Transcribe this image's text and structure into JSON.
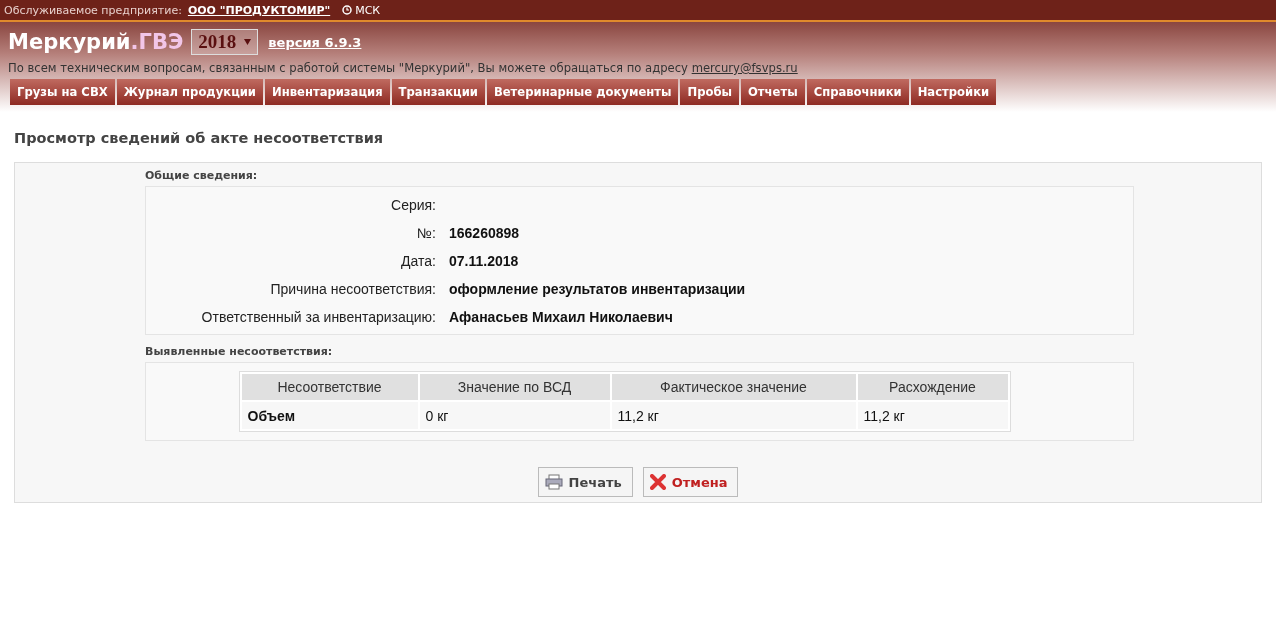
{
  "topbar": {
    "enterprise_label": "Обслуживаемое предприятие:",
    "enterprise": "ООО \"ПРОДУКТОМИР\"",
    "timezone": "МСК"
  },
  "header": {
    "brand": "Меркурий",
    "brand_suffix": ".ГВЭ",
    "year": "2018",
    "version": "версия 6.9.3",
    "support_text": "По всем техническим вопросам, связанным с работой системы \"Меркурий\", Вы можете обращаться по адресу",
    "support_email": "mercury@fsvps.ru"
  },
  "menu": [
    "Грузы на СВХ",
    "Журнал продукции",
    "Инвентаризация",
    "Транзакции",
    "Ветеринарные документы",
    "Пробы",
    "Отчеты",
    "Справочники",
    "Настройки"
  ],
  "page_title": "Просмотр сведений об акте несоответствия",
  "general": {
    "heading": "Общие сведения:",
    "fields": [
      {
        "label": "Серия:"
      },
      {
        "label": "№:",
        "value": "166260898"
      },
      {
        "label": "Дата:",
        "value": "07.11.2018"
      },
      {
        "label": "Причина несоответствия:",
        "value": "оформление результатов инвентаризации"
      },
      {
        "label": "Ответственный за инвентаризацию:",
        "value": "Афанасьев Михаил Николаевич"
      }
    ]
  },
  "discrepancies": {
    "heading": "Выявленные несоответствия:",
    "columns": [
      "Несоответствие",
      "Значение по ВСД",
      "Фактическое значение",
      "Расхождение"
    ],
    "rows": [
      [
        "Объем",
        "0 кг",
        "11,2 кг",
        "11,2 кг"
      ]
    ]
  },
  "buttons": [
    {
      "kind": "print",
      "label": "Печать"
    },
    {
      "kind": "cancel",
      "label": "Отмена"
    }
  ]
}
